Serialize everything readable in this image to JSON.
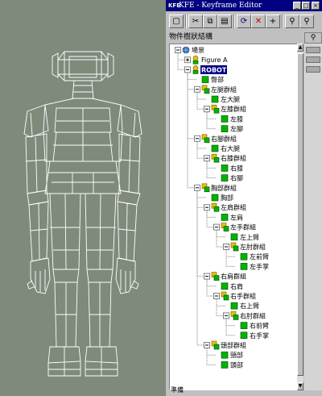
{
  "window": {
    "app_icon": "KFE",
    "title": "KFE - Keyframe Editor",
    "controls": [
      "minimize-icon",
      "maximize-icon",
      "close-icon"
    ]
  },
  "toolbar": {
    "buttons": [
      {
        "name": "new-icon",
        "glyph": "▢"
      },
      {
        "name": "cut-icon",
        "glyph": "✂"
      },
      {
        "name": "copy-icon",
        "glyph": "⧉"
      },
      {
        "name": "paste-icon",
        "glyph": "▤"
      },
      {
        "name": "refresh-icon",
        "glyph": "⟳"
      },
      {
        "name": "delete-icon",
        "glyph": "✕"
      },
      {
        "name": "add-key-icon",
        "glyph": "+"
      },
      {
        "name": "zoom-out-icon",
        "glyph": "⚲"
      },
      {
        "name": "zoom-in-icon",
        "glyph": "⚲"
      }
    ]
  },
  "panel": {
    "header": "物件樹狀結構",
    "timeline_icon": "bone-icon"
  },
  "tree": [
    {
      "label": "場景",
      "depth": 0,
      "icon": "scene-icon",
      "expander": "-"
    },
    {
      "label": "Figure A",
      "depth": 1,
      "icon": "figure-icon",
      "expander": "+"
    },
    {
      "label": "ROBOT",
      "depth": 1,
      "icon": "figure-icon",
      "expander": "-",
      "selected": true
    },
    {
      "label": "臀部",
      "depth": 2,
      "icon": "bone-icon",
      "expander": ""
    },
    {
      "label": "左腿群組",
      "depth": 2,
      "icon": "group-icon",
      "expander": "-"
    },
    {
      "label": "左大腿",
      "depth": 3,
      "icon": "bone-icon",
      "expander": ""
    },
    {
      "label": "左膝群組",
      "depth": 3,
      "icon": "group-icon",
      "expander": "-"
    },
    {
      "label": "左膝",
      "depth": 4,
      "icon": "bone-icon",
      "expander": ""
    },
    {
      "label": "左腳",
      "depth": 4,
      "icon": "bone-icon",
      "expander": ""
    },
    {
      "label": "右腳群組",
      "depth": 2,
      "icon": "group-icon",
      "expander": "-"
    },
    {
      "label": "右大腿",
      "depth": 3,
      "icon": "bone-icon",
      "expander": ""
    },
    {
      "label": "右膝群組",
      "depth": 3,
      "icon": "group-icon",
      "expander": "-"
    },
    {
      "label": "右膝",
      "depth": 4,
      "icon": "bone-icon",
      "expander": ""
    },
    {
      "label": "右腳",
      "depth": 4,
      "icon": "bone-icon",
      "expander": ""
    },
    {
      "label": "胸部群組",
      "depth": 2,
      "icon": "group-icon",
      "expander": "-"
    },
    {
      "label": "胸部",
      "depth": 3,
      "icon": "bone-icon",
      "expander": ""
    },
    {
      "label": "左肩群組",
      "depth": 3,
      "icon": "group-icon",
      "expander": "-"
    },
    {
      "label": "左肩",
      "depth": 4,
      "icon": "bone-icon",
      "expander": ""
    },
    {
      "label": "左手群組",
      "depth": 4,
      "icon": "group-icon",
      "expander": "-"
    },
    {
      "label": "左上臂",
      "depth": 5,
      "icon": "bone-icon",
      "expander": ""
    },
    {
      "label": "左肘群組",
      "depth": 5,
      "icon": "group-icon",
      "expander": "-"
    },
    {
      "label": "左前臂",
      "depth": 6,
      "icon": "bone-icon",
      "expander": ""
    },
    {
      "label": "左手掌",
      "depth": 6,
      "icon": "bone-icon",
      "expander": ""
    },
    {
      "label": "右肩群組",
      "depth": 3,
      "icon": "group-icon",
      "expander": "-"
    },
    {
      "label": "右肩",
      "depth": 4,
      "icon": "bone-icon",
      "expander": ""
    },
    {
      "label": "右手群組",
      "depth": 4,
      "icon": "group-icon",
      "expander": "-"
    },
    {
      "label": "右上臂",
      "depth": 5,
      "icon": "bone-icon",
      "expander": ""
    },
    {
      "label": "右肘群組",
      "depth": 5,
      "icon": "group-icon",
      "expander": "-"
    },
    {
      "label": "右前臂",
      "depth": 6,
      "icon": "bone-icon",
      "expander": ""
    },
    {
      "label": "右手掌",
      "depth": 6,
      "icon": "bone-icon",
      "expander": ""
    },
    {
      "label": "頭部群組",
      "depth": 3,
      "icon": "group-icon",
      "expander": "-"
    },
    {
      "label": "頸部",
      "depth": 4,
      "icon": "bone-icon",
      "expander": ""
    },
    {
      "label": "頭部",
      "depth": 4,
      "icon": "bone-icon",
      "expander": ""
    }
  ],
  "status": {
    "text": "準備"
  },
  "colors": {
    "viewport_bg": "#7f8a7b",
    "wireframe": "#ffffff",
    "titlebar": "#000080",
    "selection": "#000080",
    "bone_icon": "#00b400"
  }
}
